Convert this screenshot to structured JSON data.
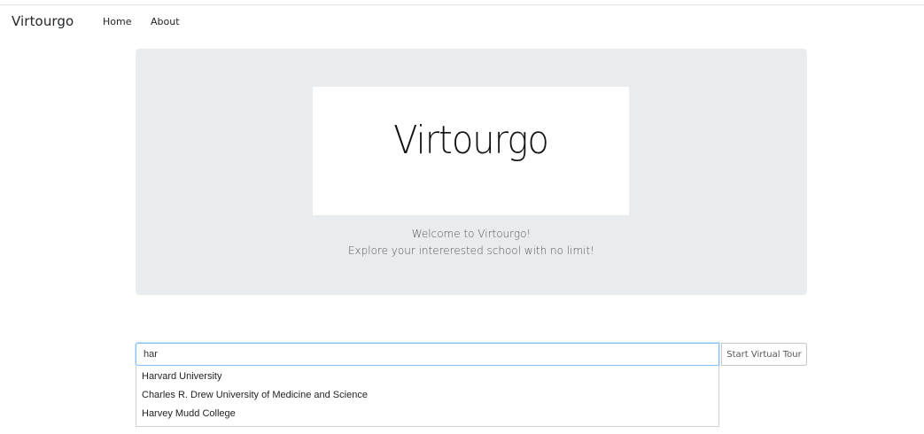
{
  "navbar": {
    "brand": "Virtourgo",
    "links": [
      {
        "label": "Home"
      },
      {
        "label": "About"
      }
    ]
  },
  "hero": {
    "logo_text": "Virtourgo",
    "welcome_line1": "Welcome to Virtourgo!",
    "welcome_line2": "Explore your intererested school with no limit!"
  },
  "search": {
    "value": "har",
    "button_label": "Start Virtual Tour",
    "suggestions": [
      {
        "label": "Harvard University"
      },
      {
        "label": "Charles R. Drew University of Medicine and Science"
      },
      {
        "label": "Harvey Mudd College"
      }
    ]
  },
  "colors": {
    "jumbotron_bg": "#e9ecef",
    "input_focus_border": "#80bdff"
  }
}
